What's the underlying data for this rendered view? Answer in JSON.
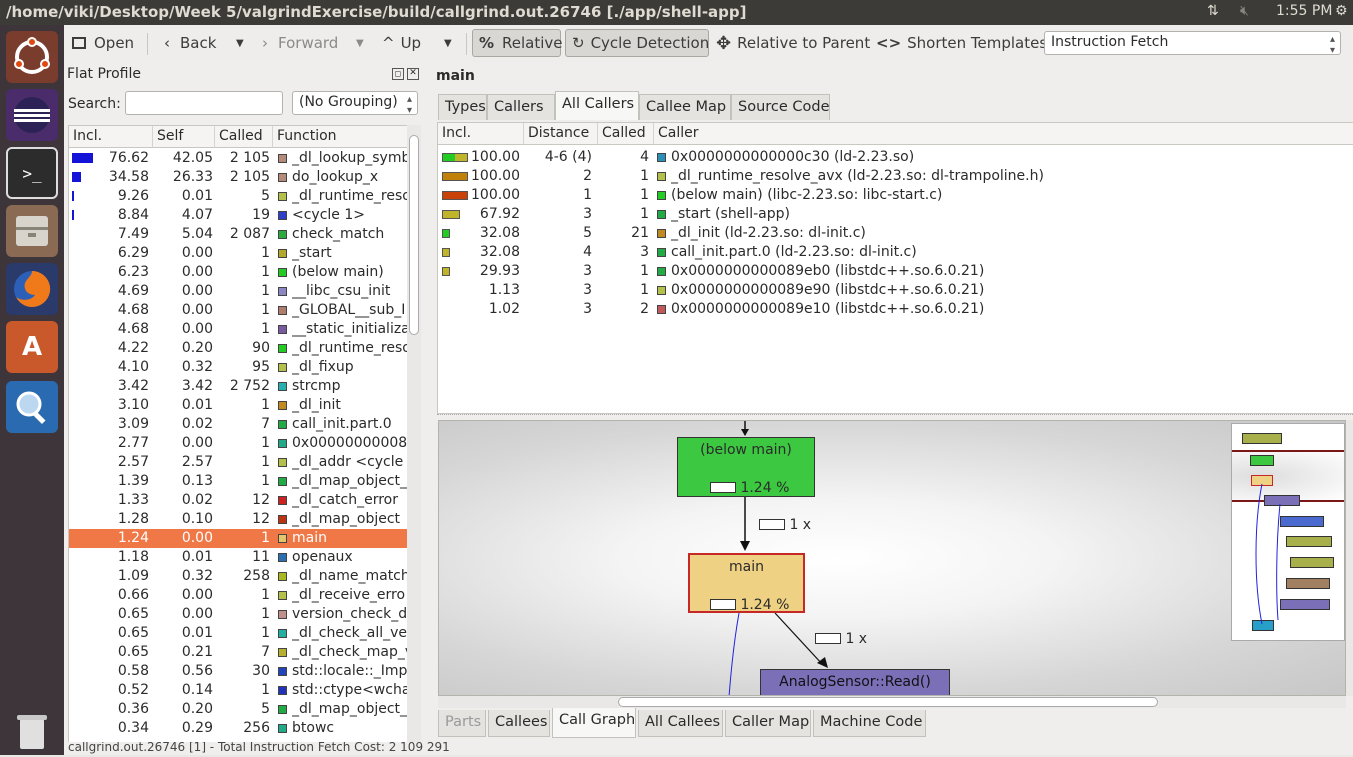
{
  "window": {
    "title": "/home/viki/Desktop/Week 5/valgrindExercise/build/callgrind.out.26746 [./app/shell-app]",
    "clock": "1:55 PM"
  },
  "toolbar": {
    "open": "Open",
    "back": "Back",
    "forward": "Forward",
    "up": "Up",
    "relative": "Relative",
    "cycle_detection": "Cycle Detection",
    "relative_to_parent": "Relative to Parent",
    "shorten_templates": "Shorten Templates",
    "event_type": "Instruction Fetch"
  },
  "flat_profile": {
    "title": "Flat Profile",
    "search_label": "Search:",
    "search_value": "",
    "grouping": "(No Grouping)",
    "columns": [
      "Incl.",
      "Self",
      "Called",
      "Function"
    ],
    "rows": [
      {
        "incl": "76.62",
        "self": "42.05",
        "called": "2 105",
        "func": "_dl_lookup_symb",
        "color": "#b48b7a",
        "bar": 0.27
      },
      {
        "incl": "34.58",
        "self": "26.33",
        "called": "2 105",
        "func": "do_lookup_x",
        "color": "#b48b7a",
        "bar": 0.12
      },
      {
        "incl": "9.26",
        "self": "0.01",
        "called": "5",
        "func": "_dl_runtime_reso",
        "color": "#b5c04a",
        "bar": 0.03
      },
      {
        "incl": "8.84",
        "self": "4.07",
        "called": "19",
        "func": "<cycle 1>",
        "color": "#2e3fc9",
        "bar": 0.03
      },
      {
        "incl": "7.49",
        "self": "5.04",
        "called": "2 087",
        "func": "check_match",
        "color": "#2bab3f",
        "bar": 0
      },
      {
        "incl": "6.29",
        "self": "0.00",
        "called": "1",
        "func": "_start",
        "color": "#b2a82a",
        "bar": 0
      },
      {
        "incl": "6.23",
        "self": "0.00",
        "called": "1",
        "func": "(below main)",
        "color": "#22cc22",
        "bar": 0
      },
      {
        "incl": "4.69",
        "self": "0.00",
        "called": "1",
        "func": "__libc_csu_init",
        "color": "#8c86c4",
        "bar": 0
      },
      {
        "incl": "4.68",
        "self": "0.00",
        "called": "1",
        "func": "_GLOBAL__sub_I",
        "color": "#b07c6c",
        "bar": 0
      },
      {
        "incl": "4.68",
        "self": "0.00",
        "called": "1",
        "func": "__static_initializa",
        "color": "#7a5aa0",
        "bar": 0
      },
      {
        "incl": "4.22",
        "self": "0.20",
        "called": "90",
        "func": "_dl_runtime_reso",
        "color": "#22cc22",
        "bar": 0
      },
      {
        "incl": "4.10",
        "self": "0.32",
        "called": "95",
        "func": "_dl_fixup",
        "color": "#b5c04a",
        "bar": 0
      },
      {
        "incl": "3.42",
        "self": "3.42",
        "called": "2 752",
        "func": "strcmp",
        "color": "#26b0b0",
        "bar": 0
      },
      {
        "incl": "3.10",
        "self": "0.01",
        "called": "1",
        "func": "_dl_init",
        "color": "#c08a20",
        "bar": 0
      },
      {
        "incl": "3.09",
        "self": "0.02",
        "called": "7",
        "func": "call_init.part.0",
        "color": "#22aa44",
        "bar": 0
      },
      {
        "incl": "2.77",
        "self": "0.00",
        "called": "1",
        "func": "0x00000000008",
        "color": "#22aa88",
        "bar": 0
      },
      {
        "incl": "2.57",
        "self": "2.57",
        "called": "1",
        "func": "_dl_addr <cycle 1",
        "color": "#b5c04a",
        "bar": 0
      },
      {
        "incl": "1.39",
        "self": "0.13",
        "called": "1",
        "func": "_dl_map_object_",
        "color": "#22aa44",
        "bar": 0
      },
      {
        "incl": "1.33",
        "self": "0.02",
        "called": "12",
        "func": "_dl_catch_error",
        "color": "#cc2222",
        "bar": 0
      },
      {
        "incl": "1.28",
        "self": "0.10",
        "called": "12",
        "func": "_dl_map_object",
        "color": "#bb3311",
        "bar": 0
      },
      {
        "incl": "1.24",
        "self": "0.00",
        "called": "1",
        "func": "main",
        "color": "#e6c46c",
        "bar": 0,
        "selected": true
      },
      {
        "incl": "1.18",
        "self": "0.01",
        "called": "11",
        "func": "openaux",
        "color": "#2a6fb0",
        "bar": 0
      },
      {
        "incl": "1.09",
        "self": "0.32",
        "called": "258",
        "func": "_dl_name_match",
        "color": "#aab820",
        "bar": 0
      },
      {
        "incl": "0.66",
        "self": "0.00",
        "called": "1",
        "func": "_dl_receive_erro",
        "color": "#b5c04a",
        "bar": 0
      },
      {
        "incl": "0.65",
        "self": "0.00",
        "called": "1",
        "func": "version_check_do",
        "color": "#c0908a",
        "bar": 0
      },
      {
        "incl": "0.65",
        "self": "0.01",
        "called": "1",
        "func": "_dl_check_all_ve",
        "color": "#22b0a0",
        "bar": 0
      },
      {
        "incl": "0.65",
        "self": "0.21",
        "called": "7",
        "func": "_dl_check_map_v",
        "color": "#b5b030",
        "bar": 0
      },
      {
        "incl": "0.58",
        "self": "0.56",
        "called": "30",
        "func": "std::locale::_Impl",
        "color": "#2244bb",
        "bar": 0
      },
      {
        "incl": "0.52",
        "self": "0.14",
        "called": "1",
        "func": "std::ctype<wchar",
        "color": "#2233bb",
        "bar": 0
      },
      {
        "incl": "0.36",
        "self": "0.20",
        "called": "5",
        "func": "_dl_map_object_",
        "color": "#22aa44",
        "bar": 0
      },
      {
        "incl": "0.34",
        "self": "0.29",
        "called": "256",
        "func": "btowc",
        "color": "#22aa88",
        "bar": 0
      }
    ]
  },
  "detail": {
    "function_name": "main",
    "tabs": [
      "Types",
      "Callers",
      "All Callers",
      "Callee Map",
      "Source Code"
    ],
    "active_tab": "All Callers",
    "columns": [
      "Incl.",
      "Distance",
      "Called",
      "Caller"
    ],
    "callers": [
      {
        "incl": "100.00",
        "distance": "4-6 (4)",
        "called": "4",
        "caller": "0x0000000000000c30 (ld-2.23.so)",
        "color": "#2a90b8",
        "bar_colors": [
          "#bfb42a",
          "#22cc22"
        ]
      },
      {
        "incl": "100.00",
        "distance": "2",
        "called": "1",
        "caller": "_dl_runtime_resolve_avx (ld-2.23.so: dl-trampoline.h)",
        "color": "#b5c04a",
        "bar_colors": [
          "#c0800a"
        ]
      },
      {
        "incl": "100.00",
        "distance": "1",
        "called": "1",
        "caller": "(below main) (libc-2.23.so: libc-start.c)",
        "color": "#22cc22",
        "bar_colors": [
          "#c8420a"
        ]
      },
      {
        "incl": "67.92",
        "distance": "3",
        "called": "1",
        "caller": "_start (shell-app)",
        "color": "#22aa44",
        "bar_colors": [
          "#bfb42a"
        ]
      },
      {
        "incl": "32.08",
        "distance": "5",
        "called": "21",
        "caller": "_dl_init (ld-2.23.so: dl-init.c)",
        "color": "#c08a20",
        "bar_colors": [
          "#22cc22"
        ]
      },
      {
        "incl": "32.08",
        "distance": "4",
        "called": "3",
        "caller": "call_init.part.0 (ld-2.23.so: dl-init.c)",
        "color": "#22aa44",
        "bar_colors": [
          "#bfb42a"
        ]
      },
      {
        "incl": "29.93",
        "distance": "3",
        "called": "1",
        "caller": "0x0000000000089eb0 (libstdc++.so.6.0.21)",
        "color": "#22aa44",
        "bar_colors": [
          "#bfb42a"
        ]
      },
      {
        "incl": "1.13",
        "distance": "3",
        "called": "1",
        "caller": "0x0000000000089e90 (libstdc++.so.6.0.21)",
        "color": "#b5c04a",
        "bar_colors": []
      },
      {
        "incl": "1.02",
        "distance": "3",
        "called": "2",
        "caller": "0x0000000000089e10 (libstdc++.so.6.0.21)",
        "color": "#c05a5a",
        "bar_colors": []
      }
    ],
    "bottom_tabs": [
      "Parts",
      "Callees",
      "Call Graph",
      "All Callees",
      "Caller Map",
      "Machine Code"
    ],
    "bottom_active": "Call Graph"
  },
  "call_graph": {
    "nodes": [
      {
        "name": "(below main)",
        "cost": "1.24 %"
      },
      {
        "name": "main",
        "cost": "1.24 %"
      },
      {
        "name": "AnalogSensor::Read()",
        "cost": ""
      }
    ],
    "edges": [
      {
        "label": "1 x"
      },
      {
        "label": "1 x"
      }
    ]
  },
  "status": "callgrind.out.26746 [1] - Total Instruction Fetch Cost: 2 109 291"
}
